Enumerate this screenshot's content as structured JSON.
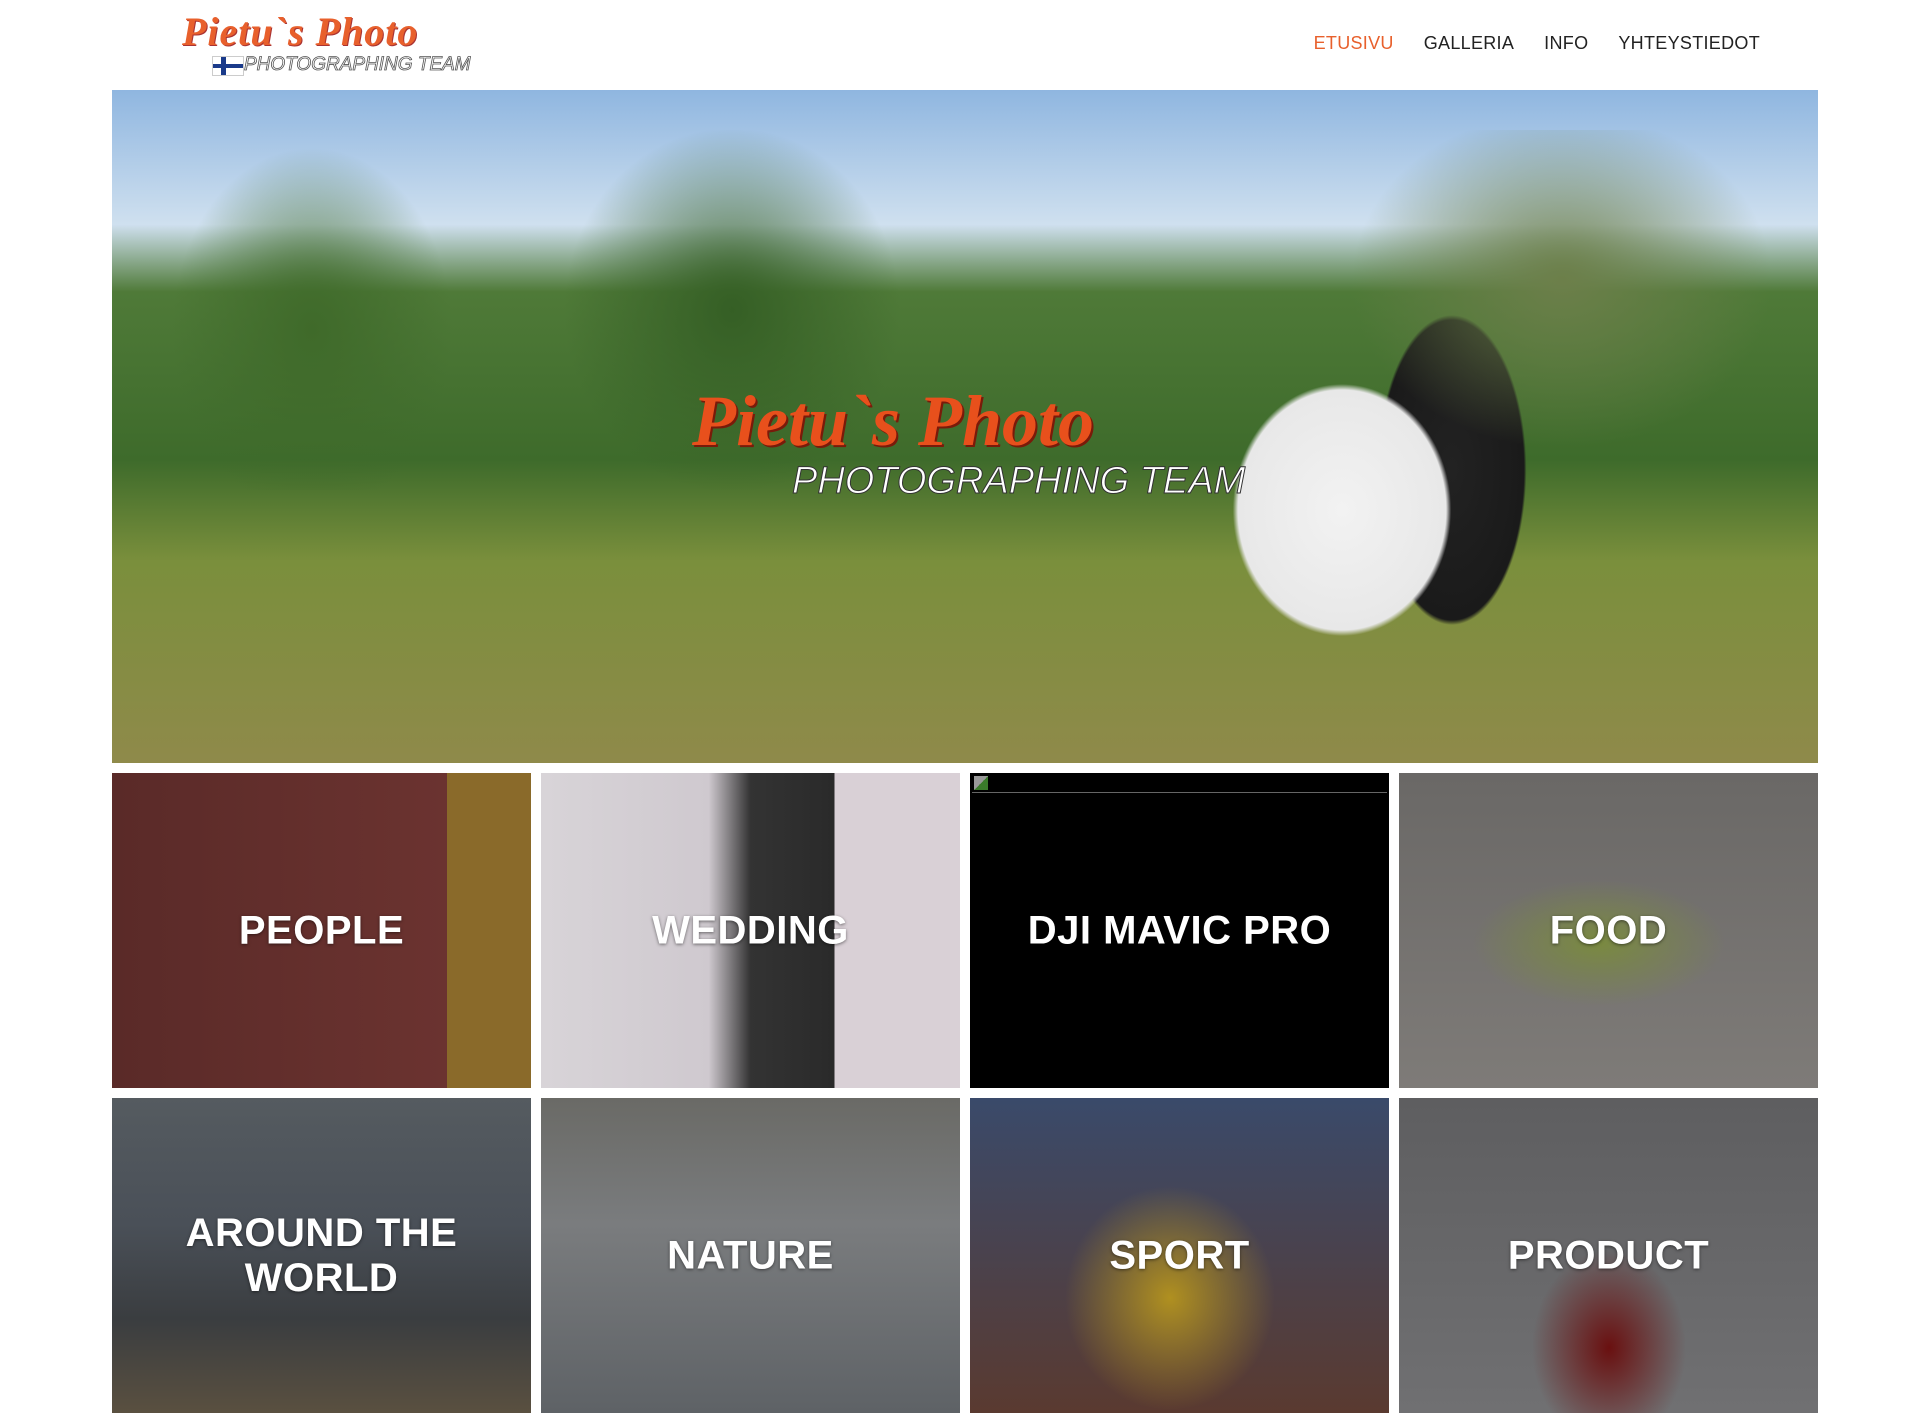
{
  "brand": {
    "name": "Pietu`s Photo",
    "tagline": "PHOTOGRAPHING TEAM",
    "accent_color": "#e8602c"
  },
  "nav": {
    "items": [
      {
        "label": "ETUSIVU",
        "active": true
      },
      {
        "label": "GALLERIA",
        "active": false
      },
      {
        "label": "INFO",
        "active": false
      },
      {
        "label": "YHTEYSTIEDOT",
        "active": false
      }
    ]
  },
  "hero": {
    "logo_main": "Pietu`s Photo",
    "logo_sub": "PHOTOGRAPHING TEAM"
  },
  "categories": [
    {
      "label": "PEOPLE"
    },
    {
      "label": "WEDDING"
    },
    {
      "label": "DJI MAVIC PRO",
      "image_broken": true
    },
    {
      "label": "FOOD"
    },
    {
      "label": "AROUND THE WORLD"
    },
    {
      "label": "NATURE"
    },
    {
      "label": "SPORT"
    },
    {
      "label": "PRODUCT"
    }
  ]
}
